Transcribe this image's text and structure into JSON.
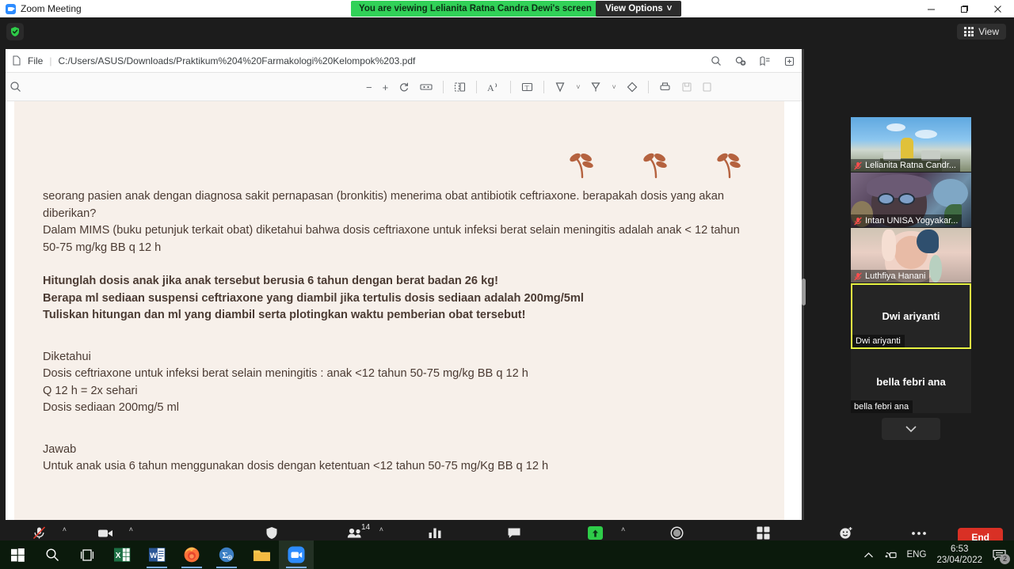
{
  "window": {
    "zoom_title": "Zoom Meeting",
    "viewing_banner": "You are viewing Lelianita Ratna Candra Dewi's screen",
    "view_options": "View Options",
    "view_options_caret": "˅",
    "minimize": "—",
    "maximize": "❐",
    "close": "✕",
    "view_pill": "View",
    "shield": "⛨"
  },
  "browser": {
    "file_label": "File",
    "separator": "|",
    "url": "C:/Users/ASUS/Downloads/Praktikum%204%20Farmakologi%20Kelompok%203.pdf",
    "search_icon": "⌕",
    "zoom_tool_icon": "⊕",
    "collections_icon": "≡",
    "add_icon": "⊞"
  },
  "pdf_toolbar": {
    "search_icon": "⌕",
    "zoom_out": "−",
    "zoom_in": "+",
    "rotate": "↻",
    "fit_page": "↔",
    "page_view": "❐",
    "read_aloud": "A",
    "text_box": "T",
    "highlight": "▽",
    "caret1": "˅",
    "draw": "✒",
    "caret2": "˅",
    "erase": "◇",
    "print": "⎙",
    "save": "Ὃe"
  },
  "document": {
    "lines": [
      {
        "text": "seorang pasien anak dengan diagnosa sakit pernapasan (bronkitis) menerima obat antibiotik ceftriaxone. berapakah dosis yang akan diberikan?",
        "bold": false
      },
      {
        "text": "Dalam MIMS (buku petunjuk terkait obat) diketahui bahwa dosis ceftriaxone untuk infeksi berat selain meningitis adalah anak < 12 tahun 50-75 mg/kg BB q 12 h",
        "bold": false
      },
      {
        "text": "Hitunglah dosis anak jika anak tersebut berusia 6 tahun dengan berat badan 26 kg!",
        "bold": true
      },
      {
        "text": "Berapa ml sediaan suspensi ceftriaxone yang diambil jika tertulis dosis sediaan adalah 200mg/5ml",
        "bold": true
      },
      {
        "text": "Tuliskan hitungan dan ml yang diambil serta plotingkan waktu pemberian obat tersebut!",
        "bold": true
      },
      {
        "text": "Diketahui",
        "bold": false
      },
      {
        "text": "Dosis ceftriaxone untuk infeksi berat selain meningitis : anak <12 tahun 50-75 mg/kg BB q 12 h",
        "bold": false
      },
      {
        "text": "Q 12 h = 2x sehari",
        "bold": false
      },
      {
        "text": "Dosis sediaan 200mg/5 ml",
        "bold": false
      },
      {
        "text": "Jawab",
        "bold": false
      },
      {
        "text": "Untuk anak usia 6 tahun menggunakan dosis dengan ketentuan <12 tahun 50-75 mg/Kg BB q 12 h",
        "bold": false
      }
    ]
  },
  "participants": [
    {
      "name": "Lelianita Ratna Candr...",
      "muted": true,
      "video": true
    },
    {
      "name": "Intan UNISA Yogyakar...",
      "muted": true,
      "video": true
    },
    {
      "name": "Luthfiya Hanani",
      "muted": true,
      "video": true
    },
    {
      "name": "Dwi ariyanti",
      "muted": false,
      "video": false,
      "active": true
    },
    {
      "name": "bella febri ana",
      "muted": false,
      "video": false,
      "active": false
    }
  ],
  "filmstrip": {
    "scroll_down": "˅"
  },
  "toolbar": {
    "mute_label": "Unmute",
    "video_label": "Stop Video",
    "security_label": "Security",
    "participants_label": "Participants",
    "participants_count": "14",
    "polls_label": "Polls",
    "chat_label": "Chat",
    "share_label": "Share Screen",
    "record_label": "Record",
    "breakout_label": "Breakout Rooms",
    "reactions_label": "Reactions",
    "more_label": "More",
    "end_label": "End",
    "caret": "˄"
  },
  "taskbar": {
    "items": [
      {
        "name": "start",
        "glyph": "⊞"
      },
      {
        "name": "search",
        "glyph": "⌕"
      },
      {
        "name": "task-view",
        "glyph": "❐"
      },
      {
        "name": "excel",
        "glyph": "X"
      },
      {
        "name": "word",
        "glyph": "W"
      },
      {
        "name": "firefox",
        "glyph": "●"
      },
      {
        "name": "mendeley",
        "glyph": "∑"
      },
      {
        "name": "file-explorer",
        "glyph": "Ὄ1"
      },
      {
        "name": "zoom",
        "glyph": "■"
      }
    ],
    "tray": {
      "chevron": "˄",
      "network": "⛶",
      "language": "ENG",
      "time": "6:53",
      "date": "23/04/2022",
      "notification_count": "2"
    }
  }
}
